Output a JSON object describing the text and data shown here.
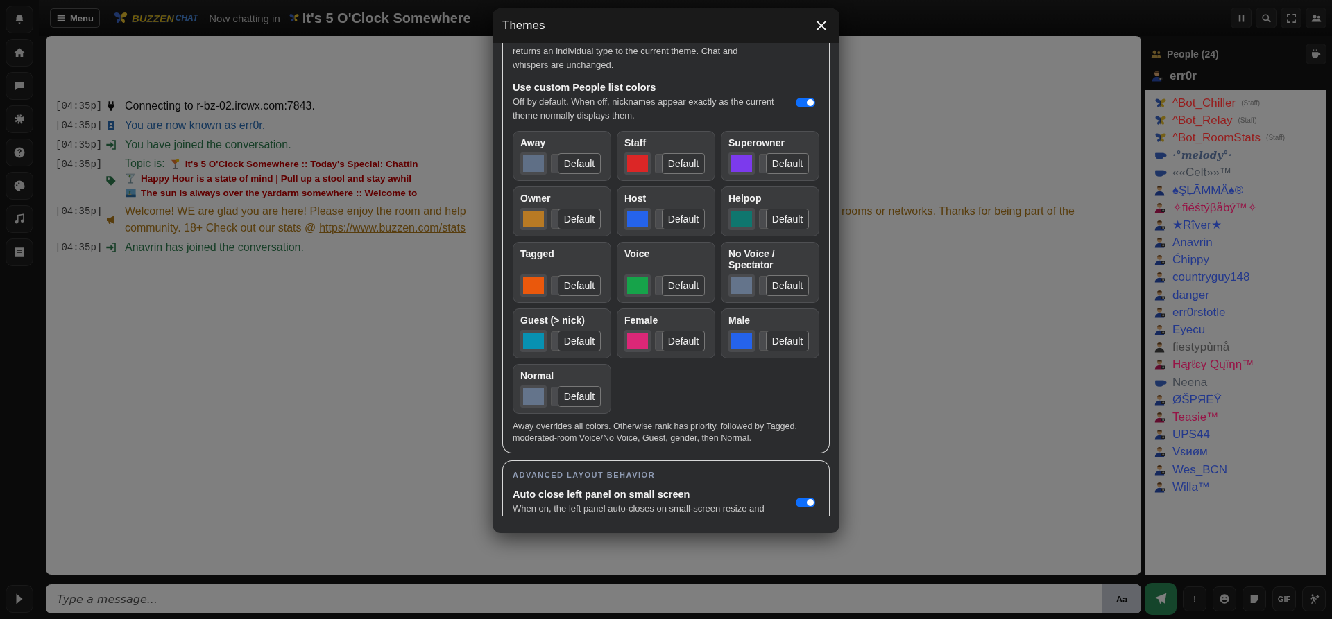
{
  "topbar": {
    "menu_label": "Menu",
    "logo": {
      "word1": "BUZZEN",
      "word2": "CHAT"
    },
    "now_chatting": "Now chatting in",
    "room_title": "It's 5 O'Clock Somewhere"
  },
  "chat": {
    "messages": [
      {
        "time": "[04:35p]",
        "kind": "connect",
        "text": "Connecting to r-bz-02.ircwx.com:7843."
      },
      {
        "time": "[04:35p]",
        "kind": "nick",
        "text": "You are now known as err0r."
      },
      {
        "time": "[04:35p]",
        "kind": "join",
        "text": "You have joined the conversation."
      },
      {
        "time": "[04:35p]",
        "kind": "topic",
        "label": "Topic is:",
        "lines": [
          {
            "kind": "cocktail",
            "text": "It's 5 O'Clock Somewhere :: Today's Special: Chattin"
          },
          {
            "kind": "martini",
            "text": "Happy Hour is a state of mind | Pull up a stool and stay awhil"
          },
          {
            "kind": "island",
            "text": "The sun is always over the yardarm somewhere :: Welcome to"
          }
        ]
      },
      {
        "time": "[04:35p]",
        "kind": "welcome",
        "text": "Welcome! WE are glad you are here! Please enjoy the room and help",
        "text_right": "rooms or networks. Thanks for being part of the",
        "line2": "community. 18+ Check out our stats @",
        "link": "https://www.buzzen.com/stats"
      },
      {
        "time": "[04:35p]",
        "kind": "join",
        "text": "Anavrin has joined the conversation."
      }
    ]
  },
  "people": {
    "title": "People (24)",
    "self": "err0r",
    "list": [
      {
        "name": "^Bot_Chiller",
        "kind": "bot",
        "color": "#961c1c",
        "badge": "(Staff)"
      },
      {
        "name": "^Bot_Relay",
        "kind": "bot",
        "color": "#961c1c",
        "badge": "(Staff)"
      },
      {
        "name": "^Bot_RoomStats",
        "kind": "bot",
        "color": "#961c1c",
        "badge": "(Staff)"
      },
      {
        "name": "·°melody°·",
        "kind": "away",
        "color": "#34425a"
      },
      {
        "name": "««Celt»»™",
        "kind": "away",
        "color": "#3e444c"
      },
      {
        "name": "♠ŞĻĀMMÄ♠®",
        "kind": "user",
        "color": "#23388c"
      },
      {
        "name": "✧fiéśtýβåbý™✧",
        "kind": "female",
        "color": "#961446"
      },
      {
        "name": "★Rîver★",
        "kind": "camera",
        "color": "#23388c"
      },
      {
        "name": "Anavrin",
        "kind": "camera",
        "color": "#23388c"
      },
      {
        "name": "Ćhippy",
        "kind": "camera",
        "color": "#23388c"
      },
      {
        "name": "countryguy148",
        "kind": "camera",
        "color": "#23388c"
      },
      {
        "name": "danger",
        "kind": "camera",
        "color": "#23388c"
      },
      {
        "name": "err0rstotle",
        "kind": "camera",
        "color": "#23388c"
      },
      {
        "name": "Eyecu",
        "kind": "camera",
        "color": "#23388c"
      },
      {
        "name": "fiestypùmå",
        "kind": "guest",
        "color": "#404040"
      },
      {
        "name": "Hąŗℓɛγ Qųïηη™",
        "kind": "female",
        "color": "#961446"
      },
      {
        "name": "Neena",
        "kind": "away",
        "color": "#3e444c"
      },
      {
        "name": "ØŠPЯËŶ",
        "kind": "camera",
        "color": "#23388c"
      },
      {
        "name": "Teasie™",
        "kind": "female",
        "color": "#961446"
      },
      {
        "name": "UPS44",
        "kind": "camera",
        "color": "#23388c"
      },
      {
        "name": "Vɛиøм",
        "kind": "camera",
        "color": "#23388c"
      },
      {
        "name": "Wes_BCN",
        "kind": "camera",
        "color": "#23388c"
      },
      {
        "name": "Willa™",
        "kind": "camera",
        "color": "#23388c"
      }
    ]
  },
  "input": {
    "placeholder": "Type a message...",
    "font_button": "Aa",
    "alert_button": "!",
    "gif_button": "GIF"
  },
  "modal": {
    "title": "Themes",
    "intro": "returns an individual type to the current theme. Chat and whispers are unchanged.",
    "toggle": {
      "title": "Use custom People list colors",
      "description": "Off by default. When off, nicknames appear exactly as the current theme normally displays them.",
      "on": true
    },
    "roles": [
      {
        "label": "Away",
        "color": "#5f6f86",
        "button": "Default"
      },
      {
        "label": "Staff",
        "color": "#dc2626",
        "button": "Default"
      },
      {
        "label": "Superowner",
        "color": "#7c3aed",
        "button": "Default"
      },
      {
        "label": "Owner",
        "color": "#b87a24",
        "button": "Default"
      },
      {
        "label": "Host",
        "color": "#2563eb",
        "button": "Default"
      },
      {
        "label": "Helpop",
        "color": "#0f766e",
        "button": "Default"
      },
      {
        "label": "Tagged",
        "color": "#ea580c",
        "button": "Default"
      },
      {
        "label": "Voice",
        "color": "#16a34a",
        "button": "Default"
      },
      {
        "label": "No Voice / Spectator",
        "color": "#64748b",
        "button": "Default"
      },
      {
        "label": "Guest (> nick)",
        "color": "#0891b2",
        "button": "Default"
      },
      {
        "label": "Female",
        "color": "#db2777",
        "button": "Default"
      },
      {
        "label": "Male",
        "color": "#2563eb",
        "button": "Default"
      },
      {
        "label": "Normal",
        "color": "#64748b",
        "button": "Default"
      }
    ],
    "note": "Away overrides all colors. Otherwise rank has priority, followed by Tagged, moderated-room Voice/No Voice, Guest, gender, then Normal.",
    "section": {
      "heading": "ADVANCED LAYOUT BEHAVIOR",
      "setting": {
        "title": "Auto close left panel on small screen",
        "description": "When on, the left panel auto-closes on small-screen resize and",
        "on": true
      }
    }
  }
}
